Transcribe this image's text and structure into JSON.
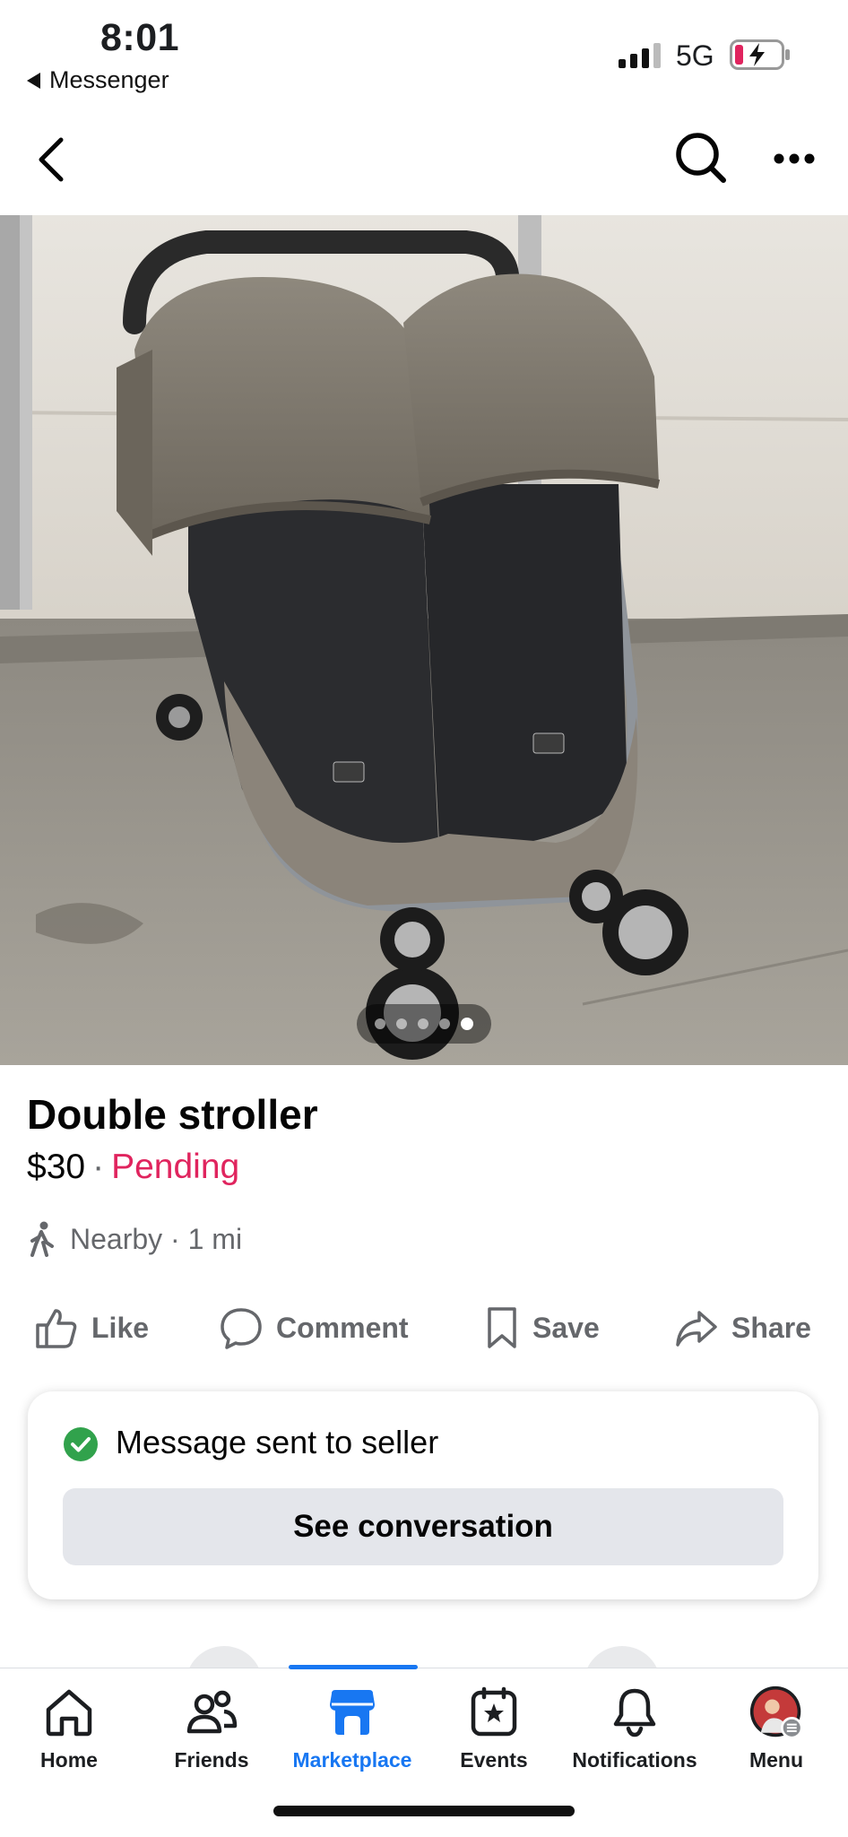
{
  "status_bar": {
    "time": "8:01",
    "back_app": "Messenger",
    "network": "5G"
  },
  "listing": {
    "title": "Double stroller",
    "price": "$30",
    "separator": "·",
    "status": "Pending",
    "distance": "Nearby · 1 mi",
    "photo_count": 5,
    "active_photo": 5
  },
  "actions": {
    "like": "Like",
    "comment": "Comment",
    "save": "Save",
    "share": "Share"
  },
  "toast": {
    "message": "Message sent to seller",
    "button": "See conversation"
  },
  "tabs": {
    "home": "Home",
    "friends": "Friends",
    "marketplace": "Marketplace",
    "events": "Events",
    "notifications": "Notifications",
    "menu": "Menu"
  },
  "colors": {
    "accent": "#1877f2",
    "pending": "#e0245e",
    "success": "#31a24c"
  }
}
